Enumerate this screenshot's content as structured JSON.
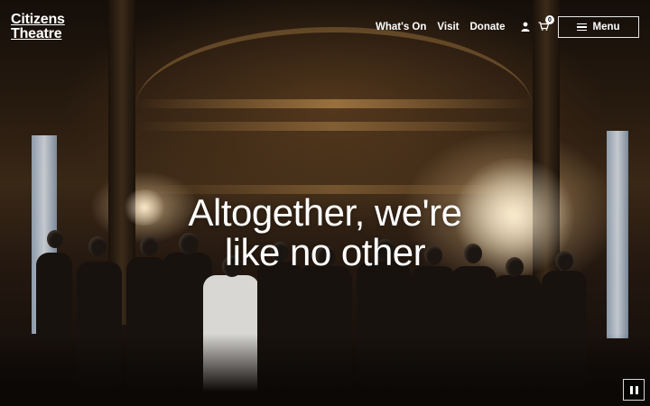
{
  "brand": {
    "line1": "Citizens",
    "line2": "Theatre"
  },
  "nav": {
    "items": [
      {
        "label": "What's On"
      },
      {
        "label": "Visit"
      },
      {
        "label": "Donate"
      }
    ]
  },
  "account": {
    "icon": "user-icon"
  },
  "basket": {
    "icon": "basket-icon",
    "count": "0"
  },
  "menu": {
    "label": "Menu",
    "icon": "hamburger-icon"
  },
  "hero": {
    "headline_line1": "Altogether, we're",
    "headline_line2": "like no other",
    "background": "backstage-crowd-photo"
  },
  "video_control": {
    "icon": "pause-icon"
  },
  "colors": {
    "text": "#ffffff",
    "overlay": "#0d0a08"
  }
}
